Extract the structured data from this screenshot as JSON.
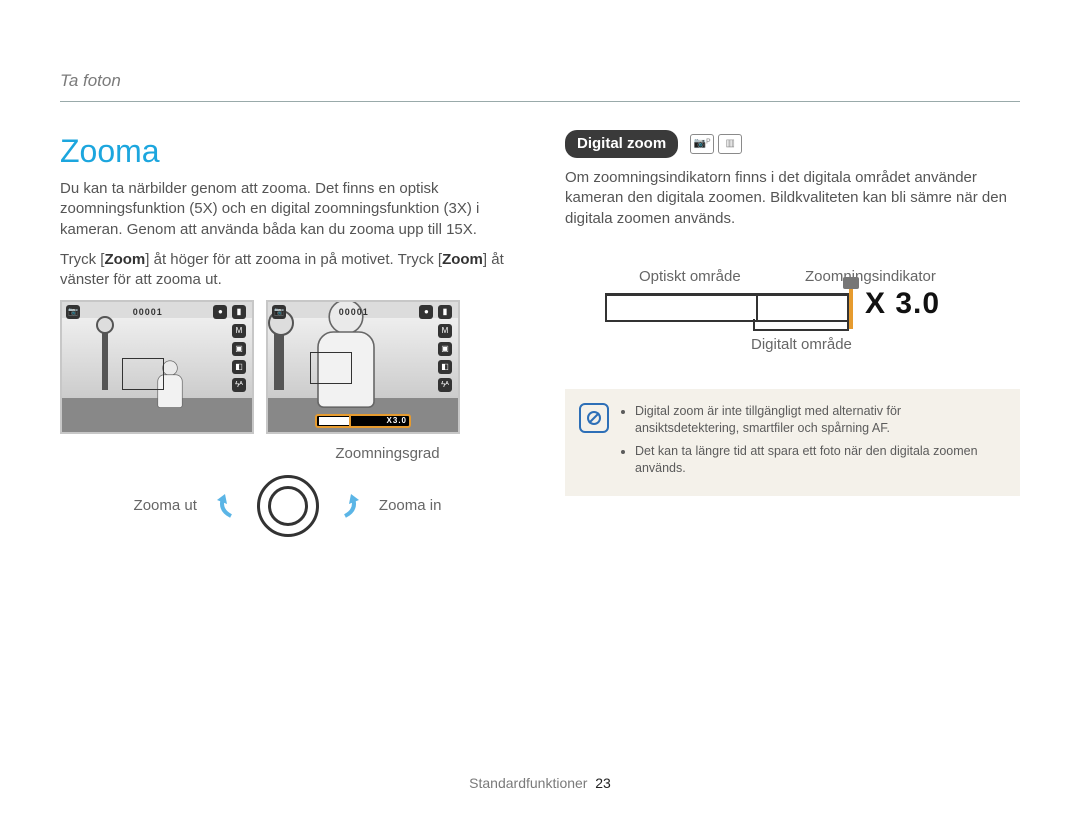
{
  "crumb": "Ta foton",
  "left": {
    "title": "Zooma",
    "intro": "Du kan ta närbilder genom att zooma. Det finns en optisk zoomningsfunktion (5X) och en digital zoomningsfunktion (3X) i kameran. Genom att använda båda kan du zooma upp till 15X.",
    "zoom_line_pre": "Tryck [",
    "zoom_key": "Zoom",
    "zoom_line_mid": "] åt höger för att zooma in på motivet. Tryck [",
    "zoom_line_post": "] åt vänster för att zooma ut.",
    "display_counter": "00001",
    "zoombar_text": "X3.0",
    "callout_zoomlevel": "Zoomningsgrad",
    "dial_out": "Zooma ut",
    "dial_in": "Zooma in"
  },
  "right": {
    "pill": "Digital zoom",
    "intro": "Om zoomningsindikatorn finns i det digitala området använder kameran den digitala zoomen. Bildkvaliteten kan bli sämre när den digitala zoomen används.",
    "range": {
      "optical": "Optiskt område",
      "indicator": "Zoomningsindikator",
      "digital": "Digitalt område",
      "x3": "X 3.0"
    },
    "notes": [
      "Digital zoom är inte tillgängligt med alternativ för ansiktsdetektering, smartfiler och spårning AF.",
      "Det kan ta längre tid att spara ett foto när den digitala zoomen används."
    ]
  },
  "footer": {
    "label": "Standardfunktioner",
    "page": "23"
  }
}
